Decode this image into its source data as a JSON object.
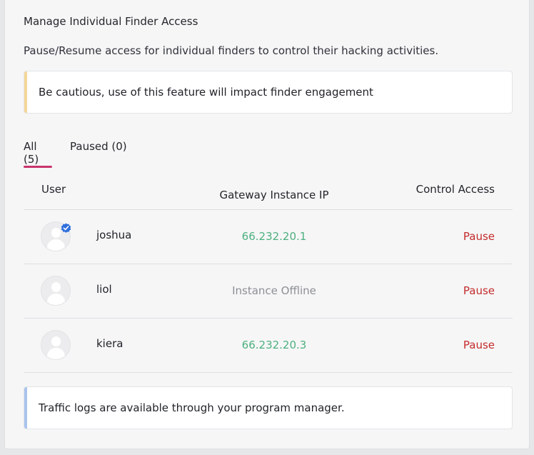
{
  "section": {
    "title": "Manage Individual Finder Access",
    "description": "Pause/Resume access for individual finders to control their hacking activities."
  },
  "warning": {
    "text": "Be cautious, use of this feature will impact finder engagement",
    "accent_color": "#f3d79a"
  },
  "tabs": [
    {
      "label": "All (5)",
      "active": true
    },
    {
      "label": "Paused (0)",
      "active": false
    }
  ],
  "table": {
    "headers": {
      "user": "User",
      "ip": "Gateway Instance IP",
      "control": "Control Access"
    },
    "rows": [
      {
        "username": "joshua",
        "ip": "66.232.20.1",
        "status": "online",
        "verified": true,
        "action": "Pause"
      },
      {
        "username": "liol",
        "ip": "Instance Offline",
        "status": "offline",
        "verified": false,
        "action": "Pause"
      },
      {
        "username": "kiera",
        "ip": "66.232.20.3",
        "status": "online",
        "verified": false,
        "action": "Pause"
      }
    ]
  },
  "info": {
    "text": "Traffic logs are available through your program manager.",
    "accent_color": "#a9c4ec"
  },
  "colors": {
    "tab_accent": "#c7356b",
    "ip_online": "#4db07e",
    "ip_offline": "#8c8f95",
    "pause_action": "#c42b2b",
    "verified_badge": "#2f6fdc"
  },
  "icons": {
    "avatar": "default-user-avatar-icon",
    "verified": "verified-badge-icon"
  }
}
